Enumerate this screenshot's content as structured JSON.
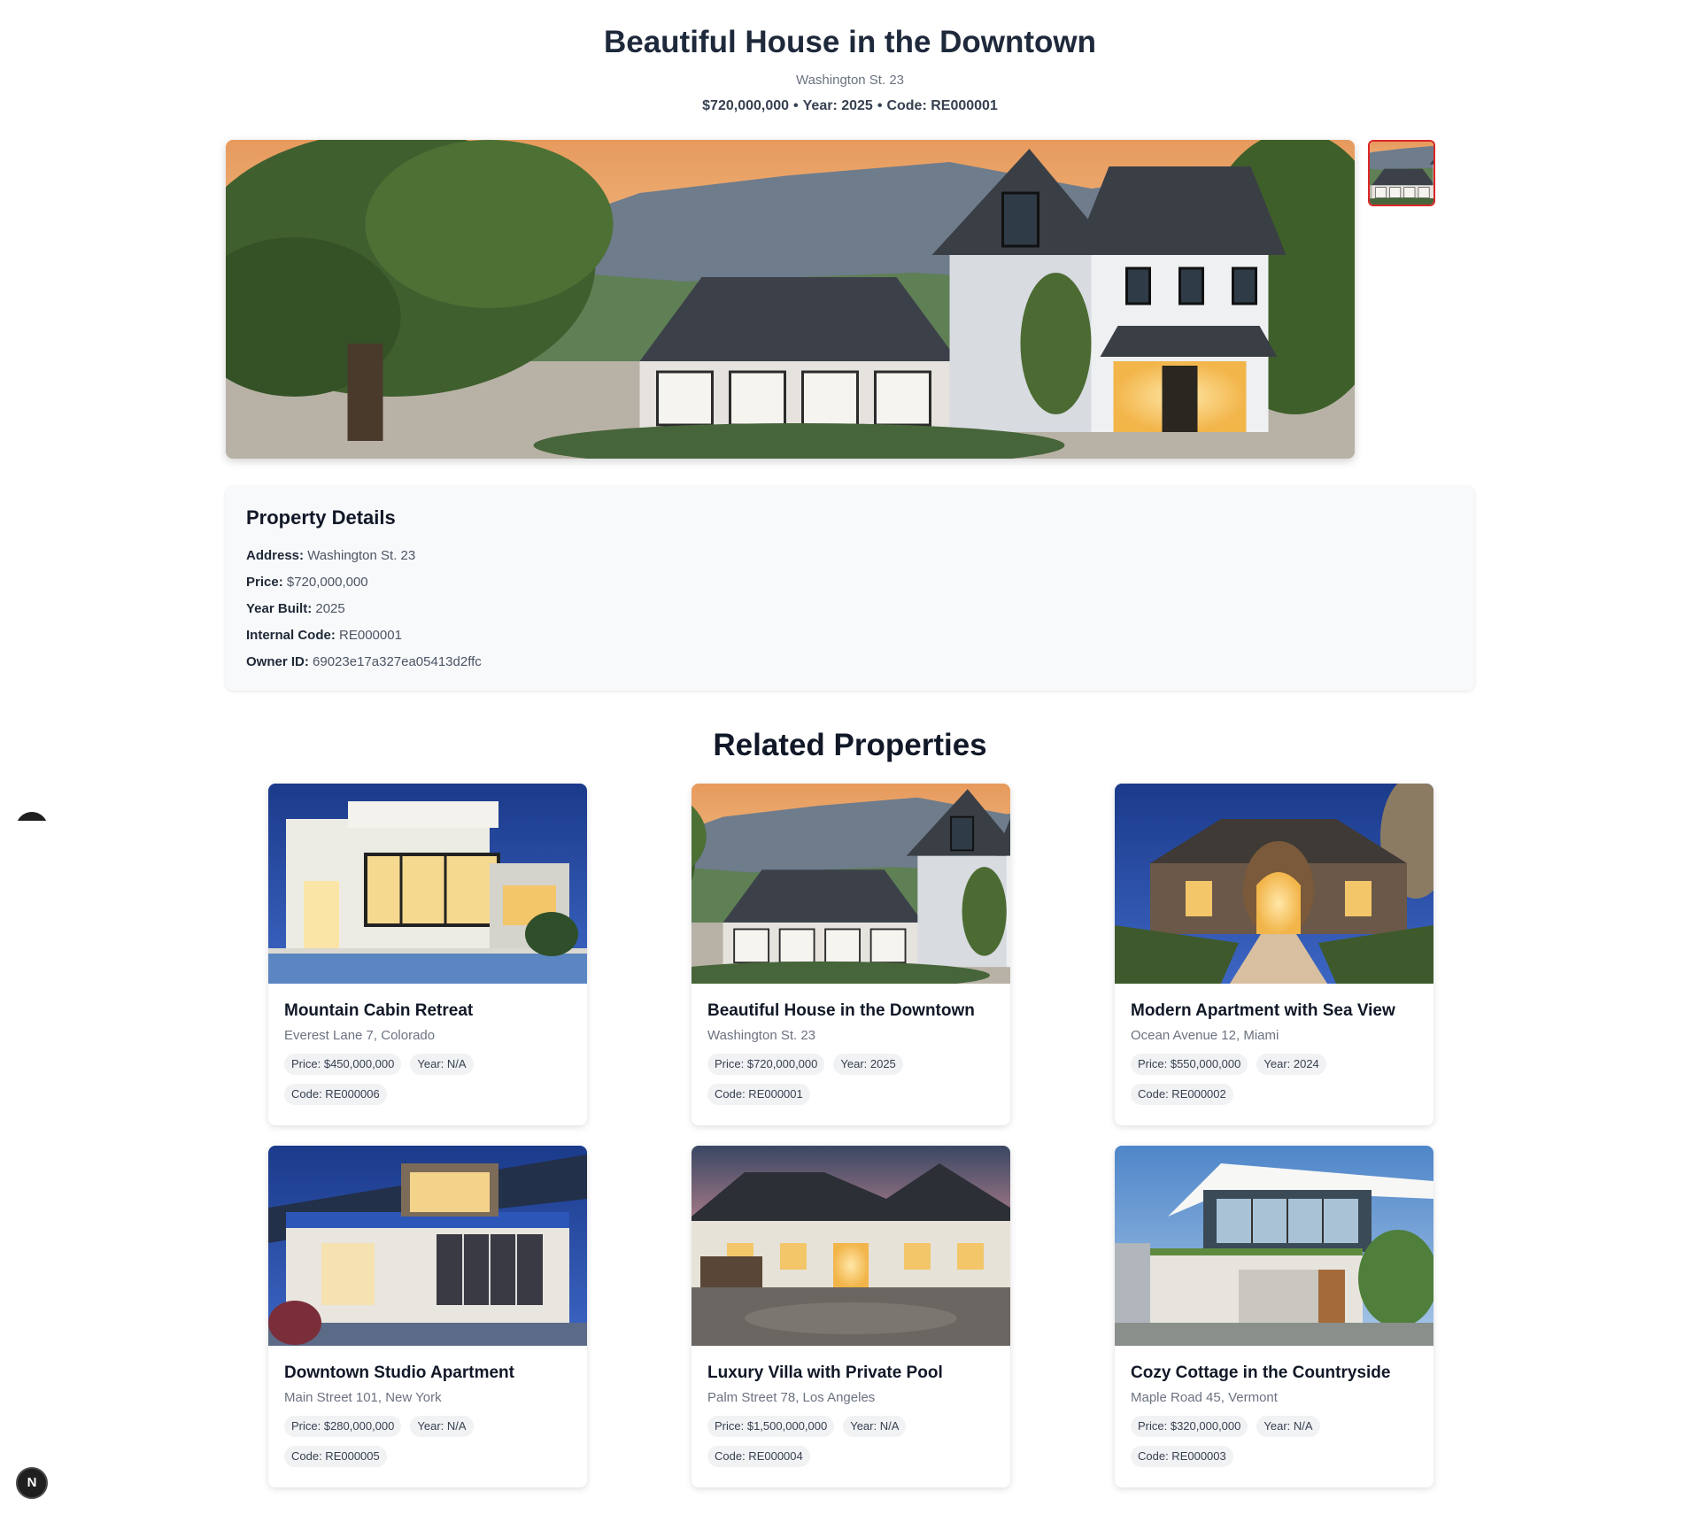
{
  "property": {
    "title": "Beautiful House in the Downtown",
    "address": "Washington St. 23",
    "price": "$720,000,000",
    "year": "Year: 2025",
    "code": "Code: RE000001"
  },
  "details": {
    "heading": "Property Details",
    "address_label": "Address:",
    "address_value": "Washington St. 23",
    "price_label": "Price:",
    "price_value": "$720,000,000",
    "year_label": "Year Built:",
    "year_value": "2025",
    "code_label": "Internal Code:",
    "code_value": "RE000001",
    "owner_label": "Owner ID:",
    "owner_value": "69023e17a327ea05413d2ffc"
  },
  "related": {
    "heading": "Related Properties",
    "cards": [
      {
        "title": "Mountain Cabin Retreat",
        "address": "Everest Lane 7, Colorado",
        "price": "Price: $450,000,000",
        "year": "Year: N/A",
        "code": "Code: RE000006"
      },
      {
        "title": "Beautiful House in the Downtown",
        "address": "Washington St. 23",
        "price": "Price: $720,000,000",
        "year": "Year: 2025",
        "code": "Code: RE000001"
      },
      {
        "title": "Modern Apartment with Sea View",
        "address": "Ocean Avenue 12, Miami",
        "price": "Price: $550,000,000",
        "year": "Year: 2024",
        "code": "Code: RE000002"
      },
      {
        "title": "Downtown Studio Apartment",
        "address": "Main Street 101, New York",
        "price": "Price: $280,000,000",
        "year": "Year: N/A",
        "code": "Code: RE000005"
      },
      {
        "title": "Luxury Villa with Private Pool",
        "address": "Palm Street 78, Los Angeles",
        "price": "Price: $1,500,000,000",
        "year": "Year: N/A",
        "code": "Code: RE000004"
      },
      {
        "title": "Cozy Cottage in the Countryside",
        "address": "Maple Road 45, Vermont",
        "price": "Price: $320,000,000",
        "year": "Year: N/A",
        "code": "Code: RE000003"
      }
    ]
  },
  "dev_badge": {
    "label": "N"
  },
  "colors": {
    "thumb_border": "#dc2626",
    "tag_bg": "#f1f2f4",
    "details_bg": "#f8f9fb"
  }
}
